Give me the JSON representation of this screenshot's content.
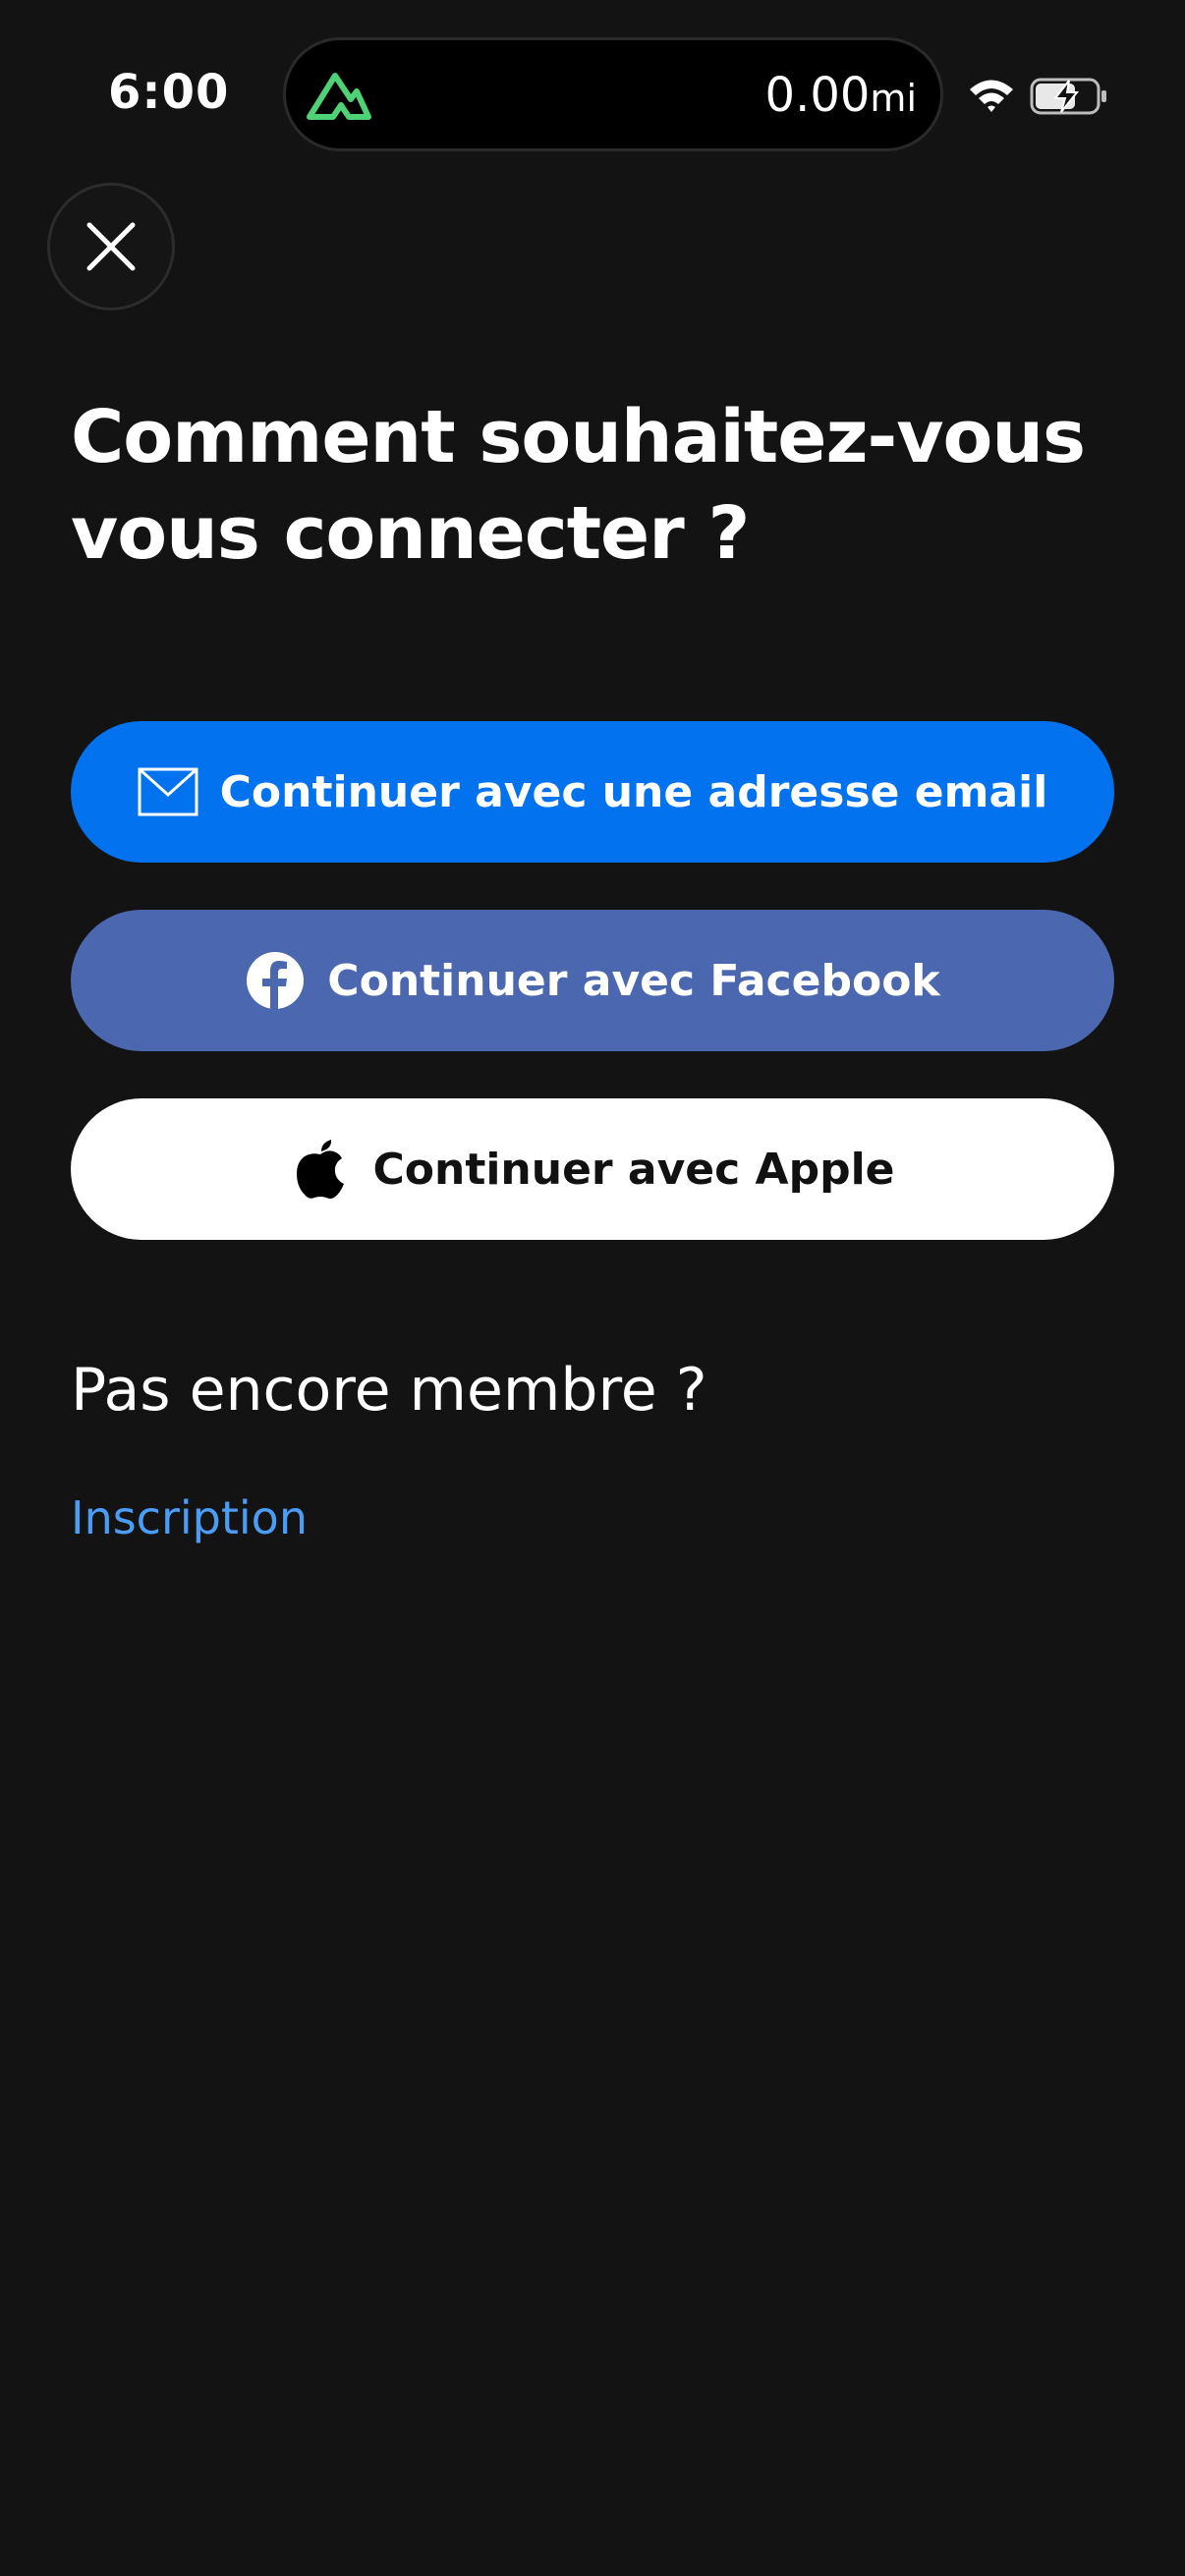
{
  "status_bar": {
    "time": "6:00",
    "distance_value": "0.00",
    "distance_unit": "mi"
  },
  "close_button": {
    "icon": "close-icon"
  },
  "title": "Comment souhaitez-vous vous connecter ?",
  "buttons": {
    "email": {
      "label": "Continuer avec une adresse email",
      "icon": "mail-icon",
      "color": "#0272ee"
    },
    "facebook": {
      "label": "Continuer avec Facebook",
      "icon": "facebook-icon",
      "color": "#4b67b0"
    },
    "apple": {
      "label": "Continuer avec Apple",
      "icon": "apple-icon",
      "color": "#ffffff"
    }
  },
  "signup": {
    "heading": "Pas encore membre ?",
    "link": "Inscription"
  },
  "colors": {
    "background": "#131313",
    "link": "#4b9cf5",
    "logo": "#4fd175"
  }
}
